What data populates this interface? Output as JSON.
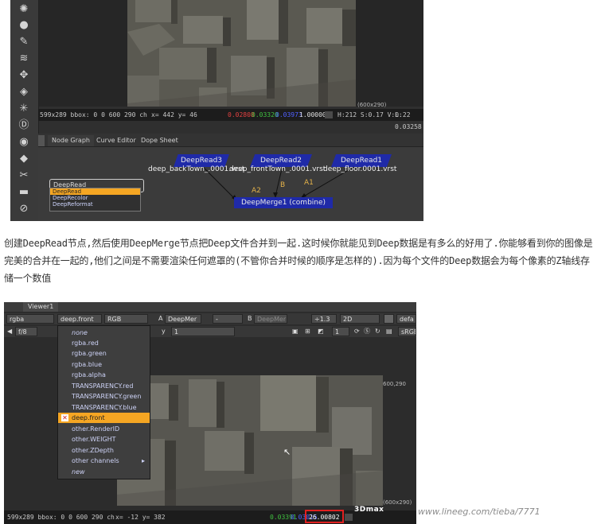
{
  "top": {
    "toolbar_icons": [
      "gear-icon",
      "circle-icon",
      "pen-icon",
      "layers-icon",
      "move-icon",
      "cube-icon",
      "sparkle-icon",
      "d-icon",
      "eye-icon",
      "tag-icon",
      "tools-icon",
      "panel-icon",
      "no-icon"
    ],
    "dim_label": "(600x290)",
    "status": {
      "bbox": "599x289 bbox: 0 0 600 290 ch",
      "coords": "x= 442 y=  46",
      "r": "0.02808",
      "g": "0.03320",
      "b": "0.03973",
      "a": "1.00000",
      "hsv": "H:212 S:0.17 V:0.22",
      "l": "L: 0.03258"
    },
    "tabs": [
      "Node Graph",
      "Curve Editor",
      "Dope Sheet"
    ],
    "nodes": {
      "n1": {
        "label": "DeepRead3",
        "caption": "deep_backTown_.0001.vrst"
      },
      "n2": {
        "label": "DeepRead2",
        "caption": "deep_frontTown_.0001.vrst"
      },
      "n3": {
        "label": "DeepRead1",
        "caption": "deep_floor.0001.vrst"
      },
      "merge": {
        "label": "DeepMerge1 (combine)"
      }
    },
    "edge_labels": [
      "A2",
      "B",
      "A1"
    ],
    "autocomplete": {
      "value": "DeepRead",
      "options": [
        "DeepRead",
        "DeepRecolor",
        "DeepReformat"
      ]
    }
  },
  "paragraph": "创建DeepRead节点,然后使用DeepMerge节点把Deep文件合并到一起.这时候你就能见到Deep数据是有多么的好用了.你能够看到你的图像是完美的合并在一起的,他们之间是不需要渲染任何遮罩的(不管你合并时候的顺序是怎样的).因为每个文件的Deep数据会为每个像素的Z轴线存储一个数值",
  "bottom": {
    "viewer_tab": "Viewer1",
    "row1": {
      "channels": "rgba",
      "layer": "deep.front",
      "rgb": "RGB",
      "a_label": "A",
      "a_input": "DeepMer",
      "dash": "-",
      "b_label": "B",
      "b_input": "DeepMer",
      "zoom": "÷1.3",
      "mode": "2D",
      "lut": "defa"
    },
    "row2": {
      "fstop": "f/8",
      "y_label": "y",
      "y_value": "1",
      "frame": "1",
      "lut2": "sRGB"
    },
    "menu_items": [
      "none",
      "rgba.red",
      "rgba.green",
      "rgba.blue",
      "rgba.alpha",
      "TRANSPARENCY.red",
      "TRANSPARENCY.green",
      "TRANSPARENCY.blue",
      "deep.front",
      "other.RenderID",
      "other.WEIGHT",
      "other.ZDepth",
      "other channels",
      "new"
    ],
    "selected_index": 8,
    "dim_top": "600,290",
    "dim_bottom": "(600x290)",
    "status": {
      "bbox": "599x289 bbox: 0 0 600 290 ch",
      "coords": "x=  -12 y= 382",
      "g": "0.03391",
      "b": "0.03015",
      "depth": "26.00802"
    }
  },
  "watermark": {
    "logo": "3Dmax",
    "url": "www.lineeg.com/tieba/7771"
  },
  "colors": {
    "node_blue": "#1f2aa8",
    "selected_orange": "#f5a623",
    "highlight_red": "#e02020"
  }
}
